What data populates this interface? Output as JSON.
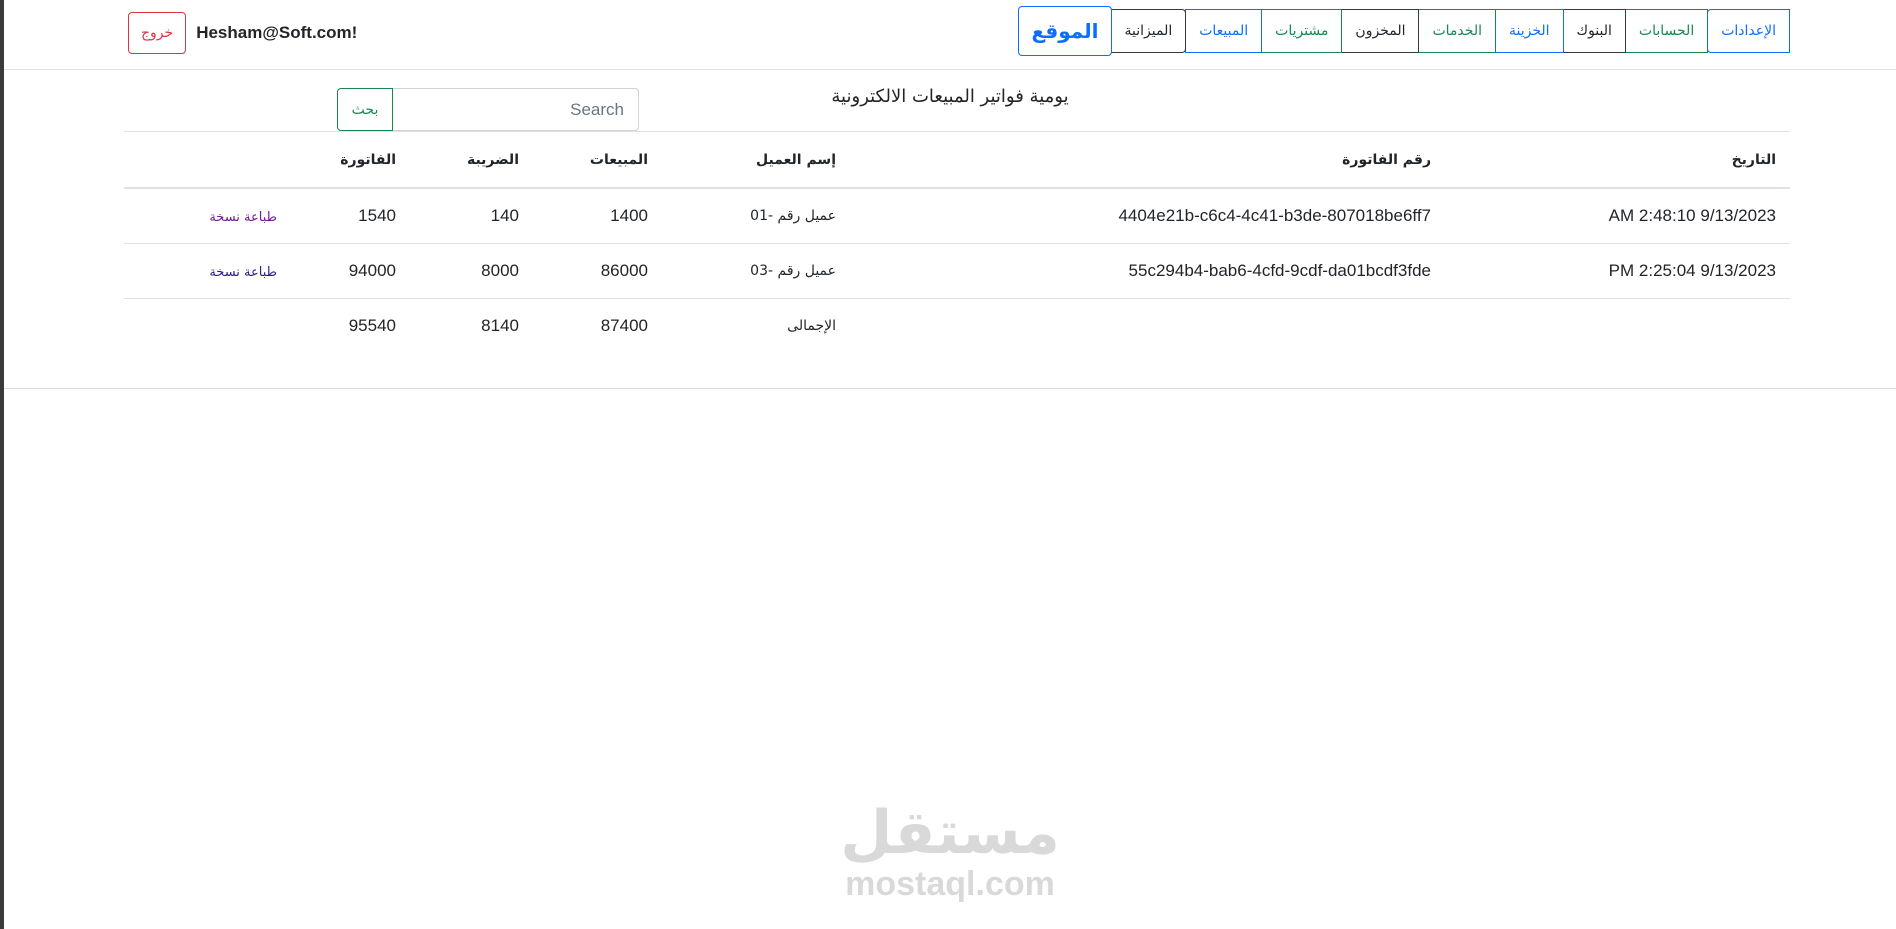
{
  "nav": {
    "brand": "الموقع",
    "items": [
      {
        "label": "الميزانية",
        "color": "#212529"
      },
      {
        "label": "المبيعات",
        "color": "#0d6efd"
      },
      {
        "label": "مشتريات",
        "color": "#198754"
      },
      {
        "label": "المخزون",
        "color": "#212529"
      },
      {
        "label": "الخدمات",
        "color": "#198754"
      },
      {
        "label": "الخزينة",
        "color": "#0d6efd"
      },
      {
        "label": "البنوك",
        "color": "#212529"
      },
      {
        "label": "الحسابات",
        "color": "#198754"
      },
      {
        "label": "الإعدادات",
        "color": "#0d6efd"
      }
    ]
  },
  "user": {
    "greeting": "Hesham@Soft.com!",
    "logout_label": "خروج"
  },
  "page": {
    "title": "يومية فواتير المبيعات الالكترونية"
  },
  "search": {
    "placeholder": "Search",
    "value": "",
    "button_label": "بحث"
  },
  "table": {
    "headers": {
      "date": "التاريخ",
      "invoice_no": "رقم الفاتورة",
      "customer": "إسم العميل",
      "sales": "المبيعات",
      "tax": "الضريبة",
      "invoice_total": "الفاتورة"
    },
    "rows": [
      {
        "date": "9/13/2023 2:48:10 AM",
        "invoice_no": "4404e21b-c6c4-4c41-b3de-807018be6ff7",
        "customer": "عميل رقم -01",
        "sales": "1400",
        "tax": "140",
        "invoice_total": "1540",
        "action": "طباعة نسخة"
      },
      {
        "date": "9/13/2023 2:25:04 PM",
        "invoice_no": "55c294b4-bab6-4cfd-9cdf-da01bcdf3fde",
        "customer": "عميل رقم -03",
        "sales": "86000",
        "tax": "8000",
        "invoice_total": "94000",
        "action": "طباعة نسخة"
      }
    ],
    "totals": {
      "label": "الإجمالى",
      "sales": "87400",
      "tax": "8140",
      "invoice_total": "95540"
    }
  },
  "watermark": {
    "arabic": "مستقل",
    "latin": "mostaql.com"
  }
}
